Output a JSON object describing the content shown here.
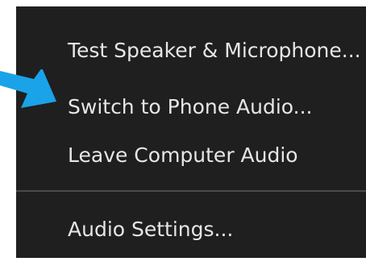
{
  "menu": {
    "items": [
      {
        "label": "Test Speaker & Microphone..."
      },
      {
        "label": "Switch to Phone Audio..."
      },
      {
        "label": "Leave Computer Audio"
      },
      {
        "label": "Audio Settings..."
      }
    ]
  },
  "annotation": {
    "arrow_icon": "arrow-right-icon",
    "arrow_color": "#1aa3e8"
  },
  "colors": {
    "menu_background": "#1f1f1f",
    "menu_text": "#e6e6e6",
    "separator": "#4a4a4a"
  }
}
